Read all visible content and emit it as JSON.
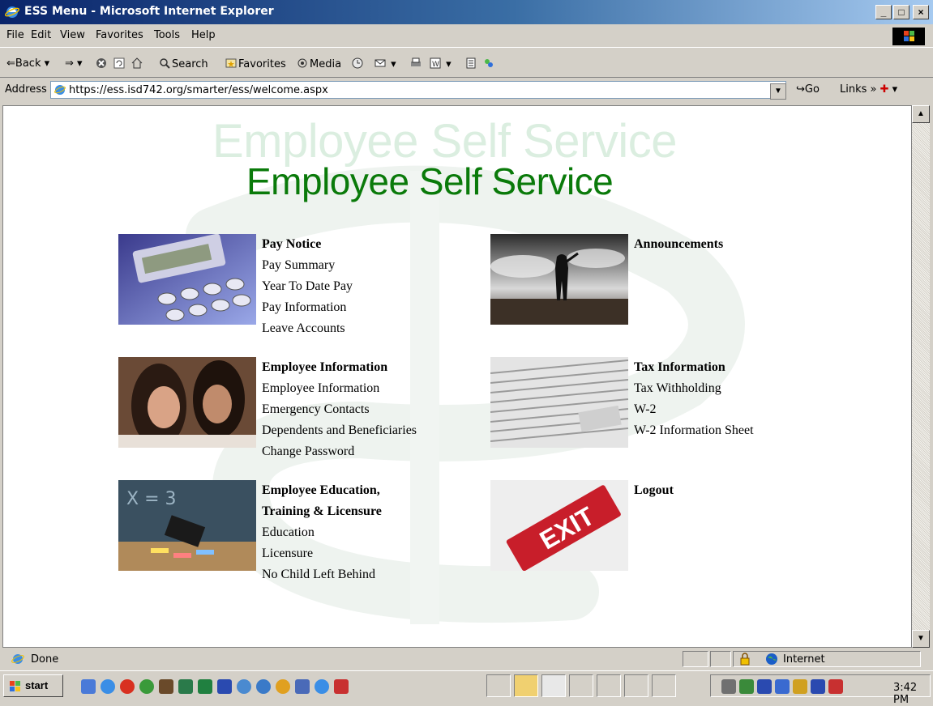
{
  "window": {
    "title": "ESS Menu - Microsoft Internet Explorer",
    "controls": {
      "minimize": "_",
      "maximize": "□",
      "close": "×"
    }
  },
  "menu": [
    "File",
    "Edit",
    "View",
    "Favorites",
    "Tools",
    "Help"
  ],
  "toolbar": {
    "back": "Back",
    "search": "Search",
    "favorites": "Favorites",
    "media": "Media"
  },
  "addressbar": {
    "label": "Address",
    "url": "https://ess.isd742.org/smarter/ess/welcome.aspx",
    "go": "Go",
    "links": "Links"
  },
  "page": {
    "heading_ghost": "Employee Self Service",
    "heading": "Employee Self Service",
    "sections": {
      "pay": {
        "title": "Pay Notice",
        "links": [
          "Pay Summary",
          "Year To Date Pay",
          "Pay Information",
          "Leave Accounts"
        ]
      },
      "announcements": {
        "title": "Announcements"
      },
      "employee_info": {
        "title": "Employee Information",
        "links": [
          "Employee Information",
          "Emergency Contacts",
          "Dependents and Beneficiaries",
          "Change Password"
        ]
      },
      "tax": {
        "title": "Tax Information",
        "links": [
          "Tax Withholding",
          "W-2",
          "W-2 Information Sheet"
        ]
      },
      "education": {
        "title_line1": "Employee Education,",
        "title_line2": "Training & Licensure",
        "links": [
          "Education",
          "Licensure",
          "No Child Left Behind"
        ]
      },
      "logout": {
        "title": "Logout",
        "sign_text": "EXIT"
      }
    }
  },
  "statusbar": {
    "status": "Done",
    "zone": "Internet"
  },
  "taskbar": {
    "start": "start",
    "clock": "3:42 PM"
  },
  "colors": {
    "heading_green": "#0a7a0a",
    "ghost_green": "#dbeee0",
    "titlebar_blue": "#0a246a",
    "chrome": "#d4d0c8"
  }
}
